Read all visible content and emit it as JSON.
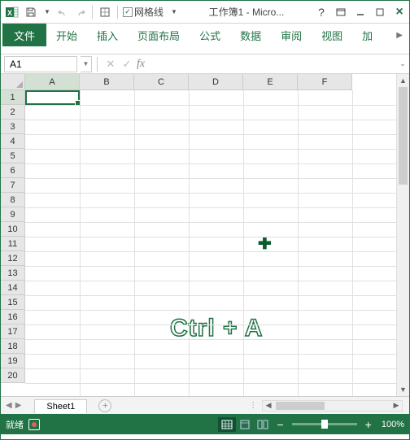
{
  "titlebar": {
    "gridlines_label": "网格线",
    "gridlines_checked": true,
    "title": "工作簿1 - Micro...",
    "help_icon": "?"
  },
  "ribbon": {
    "tabs": {
      "file": "文件",
      "home": "开始",
      "insert": "插入",
      "pagelayout": "页面布局",
      "formulas": "公式",
      "data": "数据",
      "review": "审阅",
      "view": "视图",
      "addin": "加"
    }
  },
  "namebox": {
    "value": "A1"
  },
  "formula_bar": {
    "fx": "fx",
    "value": ""
  },
  "grid": {
    "columns": [
      "A",
      "B",
      "C",
      "D",
      "E",
      "F"
    ],
    "rows": [
      "1",
      "2",
      "3",
      "4",
      "5",
      "6",
      "7",
      "8",
      "9",
      "10",
      "11",
      "12",
      "13",
      "14",
      "15",
      "16",
      "17",
      "18",
      "19",
      "20"
    ],
    "active_col": "A",
    "active_row": "1"
  },
  "overlay": {
    "shortcut_text": "Ctrl + A"
  },
  "sheet": {
    "name": "Sheet1",
    "add": "+"
  },
  "status": {
    "ready": "就绪",
    "zoom": "100%",
    "minus": "−",
    "plus": "+"
  },
  "colors": {
    "accent": "#217346"
  }
}
